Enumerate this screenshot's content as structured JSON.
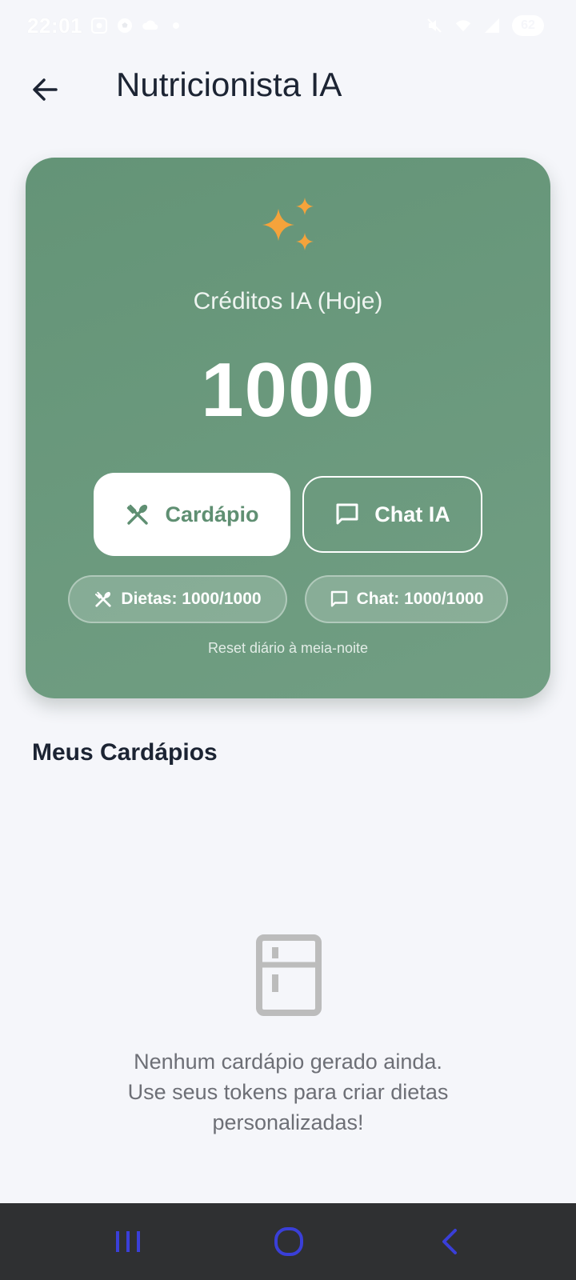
{
  "status_bar": {
    "time": "22:01",
    "battery": "62",
    "icons": [
      "screen-record-icon",
      "soccer-ball-icon",
      "cloud-icon",
      "notification-dot-icon",
      "mute-icon",
      "wifi-icon",
      "signal-icon",
      "battery-icon"
    ]
  },
  "app_bar": {
    "back_icon": "arrow-left-icon",
    "title": "Nutricionista IA"
  },
  "credits_card": {
    "icon": "sparkles-icon",
    "label": "Créditos IA (Hoje)",
    "value": "1000",
    "buttons": {
      "cardapio": {
        "label": "Cardápio",
        "icon": "fork-knife-icon"
      },
      "chat": {
        "label": "Chat IA",
        "icon": "chat-bubble-icon"
      }
    },
    "chips": {
      "dietas": {
        "label": "Dietas: 1000/1000",
        "icon": "fork-knife-icon"
      },
      "chat": {
        "label": "Chat: 1000/1000",
        "icon": "chat-bubble-icon"
      }
    },
    "reset_note": "Reset diário à meia-noite"
  },
  "section": {
    "title": "Meus Cardápios",
    "empty_state": {
      "icon": "fridge-icon",
      "line1": "Nenhum cardápio gerado ainda.",
      "line2": "Use seus tokens para criar dietas",
      "line3": "personalizadas!"
    }
  },
  "nav_bar": {
    "icons": [
      "recent-apps-icon",
      "home-icon",
      "back-icon"
    ]
  },
  "colors": {
    "card_green": "#6b9a7d",
    "accent_orange": "#f5a33b",
    "background": "#f5f6fa",
    "button_text_green": "#5f8f72"
  }
}
